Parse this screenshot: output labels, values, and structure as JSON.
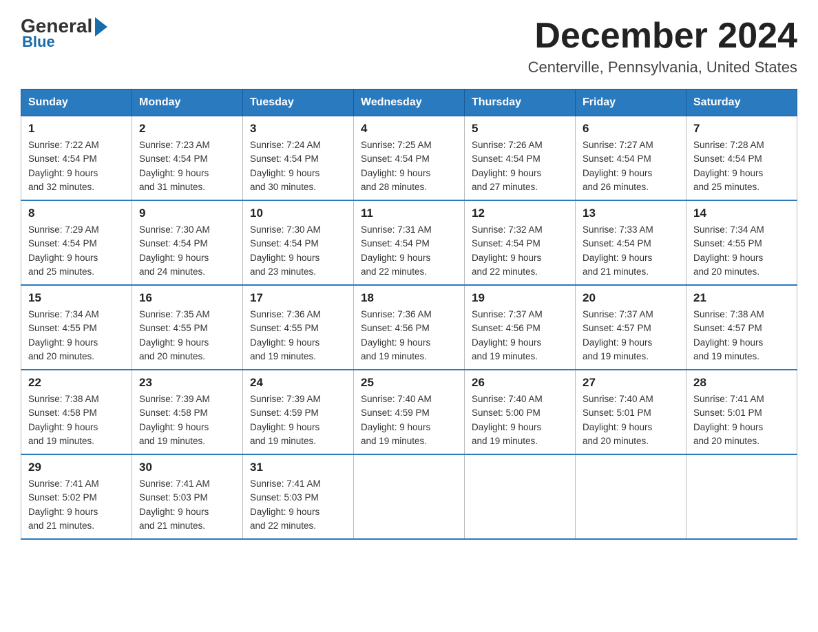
{
  "header": {
    "logo_general": "General",
    "logo_blue": "Blue",
    "month_title": "December 2024",
    "location": "Centerville, Pennsylvania, United States"
  },
  "weekdays": [
    "Sunday",
    "Monday",
    "Tuesday",
    "Wednesday",
    "Thursday",
    "Friday",
    "Saturday"
  ],
  "weeks": [
    [
      {
        "day": "1",
        "sunrise": "7:22 AM",
        "sunset": "4:54 PM",
        "daylight": "9 hours and 32 minutes."
      },
      {
        "day": "2",
        "sunrise": "7:23 AM",
        "sunset": "4:54 PM",
        "daylight": "9 hours and 31 minutes."
      },
      {
        "day": "3",
        "sunrise": "7:24 AM",
        "sunset": "4:54 PM",
        "daylight": "9 hours and 30 minutes."
      },
      {
        "day": "4",
        "sunrise": "7:25 AM",
        "sunset": "4:54 PM",
        "daylight": "9 hours and 28 minutes."
      },
      {
        "day": "5",
        "sunrise": "7:26 AM",
        "sunset": "4:54 PM",
        "daylight": "9 hours and 27 minutes."
      },
      {
        "day": "6",
        "sunrise": "7:27 AM",
        "sunset": "4:54 PM",
        "daylight": "9 hours and 26 minutes."
      },
      {
        "day": "7",
        "sunrise": "7:28 AM",
        "sunset": "4:54 PM",
        "daylight": "9 hours and 25 minutes."
      }
    ],
    [
      {
        "day": "8",
        "sunrise": "7:29 AM",
        "sunset": "4:54 PM",
        "daylight": "9 hours and 25 minutes."
      },
      {
        "day": "9",
        "sunrise": "7:30 AM",
        "sunset": "4:54 PM",
        "daylight": "9 hours and 24 minutes."
      },
      {
        "day": "10",
        "sunrise": "7:30 AM",
        "sunset": "4:54 PM",
        "daylight": "9 hours and 23 minutes."
      },
      {
        "day": "11",
        "sunrise": "7:31 AM",
        "sunset": "4:54 PM",
        "daylight": "9 hours and 22 minutes."
      },
      {
        "day": "12",
        "sunrise": "7:32 AM",
        "sunset": "4:54 PM",
        "daylight": "9 hours and 22 minutes."
      },
      {
        "day": "13",
        "sunrise": "7:33 AM",
        "sunset": "4:54 PM",
        "daylight": "9 hours and 21 minutes."
      },
      {
        "day": "14",
        "sunrise": "7:34 AM",
        "sunset": "4:55 PM",
        "daylight": "9 hours and 20 minutes."
      }
    ],
    [
      {
        "day": "15",
        "sunrise": "7:34 AM",
        "sunset": "4:55 PM",
        "daylight": "9 hours and 20 minutes."
      },
      {
        "day": "16",
        "sunrise": "7:35 AM",
        "sunset": "4:55 PM",
        "daylight": "9 hours and 20 minutes."
      },
      {
        "day": "17",
        "sunrise": "7:36 AM",
        "sunset": "4:55 PM",
        "daylight": "9 hours and 19 minutes."
      },
      {
        "day": "18",
        "sunrise": "7:36 AM",
        "sunset": "4:56 PM",
        "daylight": "9 hours and 19 minutes."
      },
      {
        "day": "19",
        "sunrise": "7:37 AM",
        "sunset": "4:56 PM",
        "daylight": "9 hours and 19 minutes."
      },
      {
        "day": "20",
        "sunrise": "7:37 AM",
        "sunset": "4:57 PM",
        "daylight": "9 hours and 19 minutes."
      },
      {
        "day": "21",
        "sunrise": "7:38 AM",
        "sunset": "4:57 PM",
        "daylight": "9 hours and 19 minutes."
      }
    ],
    [
      {
        "day": "22",
        "sunrise": "7:38 AM",
        "sunset": "4:58 PM",
        "daylight": "9 hours and 19 minutes."
      },
      {
        "day": "23",
        "sunrise": "7:39 AM",
        "sunset": "4:58 PM",
        "daylight": "9 hours and 19 minutes."
      },
      {
        "day": "24",
        "sunrise": "7:39 AM",
        "sunset": "4:59 PM",
        "daylight": "9 hours and 19 minutes."
      },
      {
        "day": "25",
        "sunrise": "7:40 AM",
        "sunset": "4:59 PM",
        "daylight": "9 hours and 19 minutes."
      },
      {
        "day": "26",
        "sunrise": "7:40 AM",
        "sunset": "5:00 PM",
        "daylight": "9 hours and 19 minutes."
      },
      {
        "day": "27",
        "sunrise": "7:40 AM",
        "sunset": "5:01 PM",
        "daylight": "9 hours and 20 minutes."
      },
      {
        "day": "28",
        "sunrise": "7:41 AM",
        "sunset": "5:01 PM",
        "daylight": "9 hours and 20 minutes."
      }
    ],
    [
      {
        "day": "29",
        "sunrise": "7:41 AM",
        "sunset": "5:02 PM",
        "daylight": "9 hours and 21 minutes."
      },
      {
        "day": "30",
        "sunrise": "7:41 AM",
        "sunset": "5:03 PM",
        "daylight": "9 hours and 21 minutes."
      },
      {
        "day": "31",
        "sunrise": "7:41 AM",
        "sunset": "5:03 PM",
        "daylight": "9 hours and 22 minutes."
      },
      null,
      null,
      null,
      null
    ]
  ],
  "labels": {
    "sunrise_prefix": "Sunrise: ",
    "sunset_prefix": "Sunset: ",
    "daylight_prefix": "Daylight: "
  }
}
